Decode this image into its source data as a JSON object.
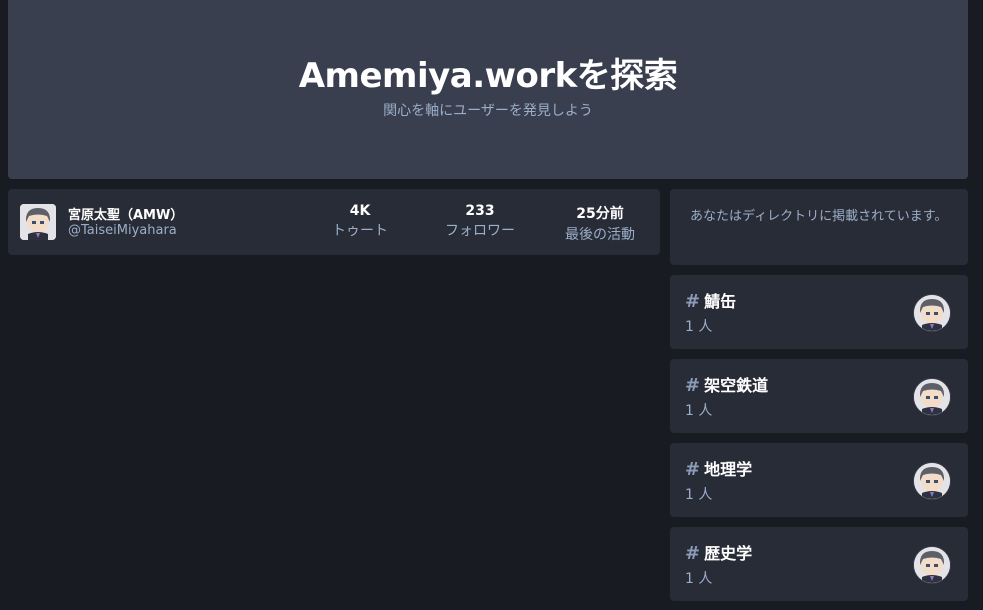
{
  "hero": {
    "title": "Amemiya.workを探索",
    "subtitle": "関心を軸にユーザーを発見しよう"
  },
  "account": {
    "display_name": "宮原太聖（AMW）",
    "handle": "@TaiseiMiyahara",
    "stats": [
      {
        "value": "4K",
        "label": "トゥート"
      },
      {
        "value": "233",
        "label": "フォロワー"
      },
      {
        "value": "25分前",
        "label": "最後の活動"
      }
    ]
  },
  "sidebar": {
    "notice": "あなたはディレクトリに掲載されています。",
    "hashtags": [
      {
        "name": "鯖缶",
        "count": "1 人"
      },
      {
        "name": "架空鉄道",
        "count": "1 人"
      },
      {
        "name": "地理学",
        "count": "1 人"
      },
      {
        "name": "歴史学",
        "count": "1 人"
      }
    ]
  },
  "icons": {
    "hashtag": "hash-icon",
    "avatar": "avatar-image"
  },
  "colors": {
    "background": "#191b22",
    "hero": "#393f4f",
    "card": "#282c37",
    "muted_text": "#9baec8"
  }
}
